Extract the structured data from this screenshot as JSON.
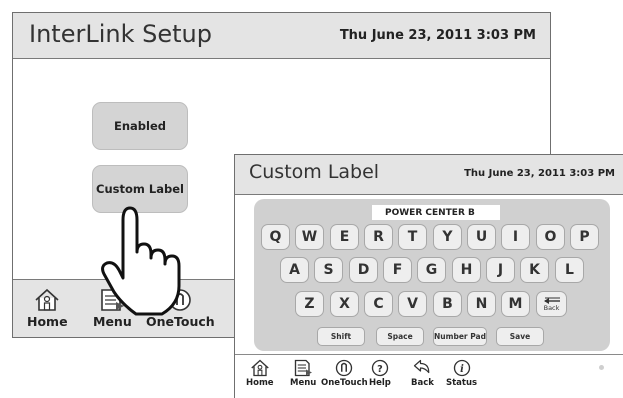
{
  "setup_screen": {
    "title": "InterLink Setup",
    "datetime": "Thu June 23, 2011  3:03 PM",
    "buttons": {
      "enabled": "Enabled",
      "custom_label": "Custom Label"
    },
    "nav": [
      {
        "label": "Home",
        "icon": "home-icon"
      },
      {
        "label": "Menu",
        "icon": "menu-icon"
      },
      {
        "label": "OneTouch",
        "icon": "onetouch-icon"
      }
    ]
  },
  "custom_label_screen": {
    "title": "Custom Label",
    "datetime": "Thu June 23, 2011  3:03 PM",
    "entry_value": "POWER CENTER B",
    "keyboard": {
      "row1": [
        "Q",
        "W",
        "E",
        "R",
        "T",
        "Y",
        "U",
        "I",
        "O",
        "P"
      ],
      "row2": [
        "A",
        "S",
        "D",
        "F",
        "G",
        "H",
        "J",
        "K",
        "L"
      ],
      "row3": [
        "Z",
        "X",
        "C",
        "V",
        "B",
        "N",
        "M"
      ],
      "back_key": "Back",
      "function_keys": {
        "shift": "Shift",
        "space": "Space",
        "number_pad": "Number Pad",
        "save": "Save"
      }
    },
    "nav": [
      {
        "label": "Home",
        "icon": "home-icon"
      },
      {
        "label": "Menu",
        "icon": "menu-icon"
      },
      {
        "label": "OneTouch",
        "icon": "onetouch-icon"
      },
      {
        "label": "Help",
        "icon": "help-icon"
      },
      {
        "label": "Back",
        "icon": "back-icon"
      },
      {
        "label": "Status",
        "icon": "status-icon"
      }
    ]
  },
  "colors": {
    "bar": "#e4e4e4",
    "button": "#d4d4d4",
    "keyboard": "#d0d0d0",
    "key": "#eeeeee",
    "border": "#6f6f6f"
  }
}
